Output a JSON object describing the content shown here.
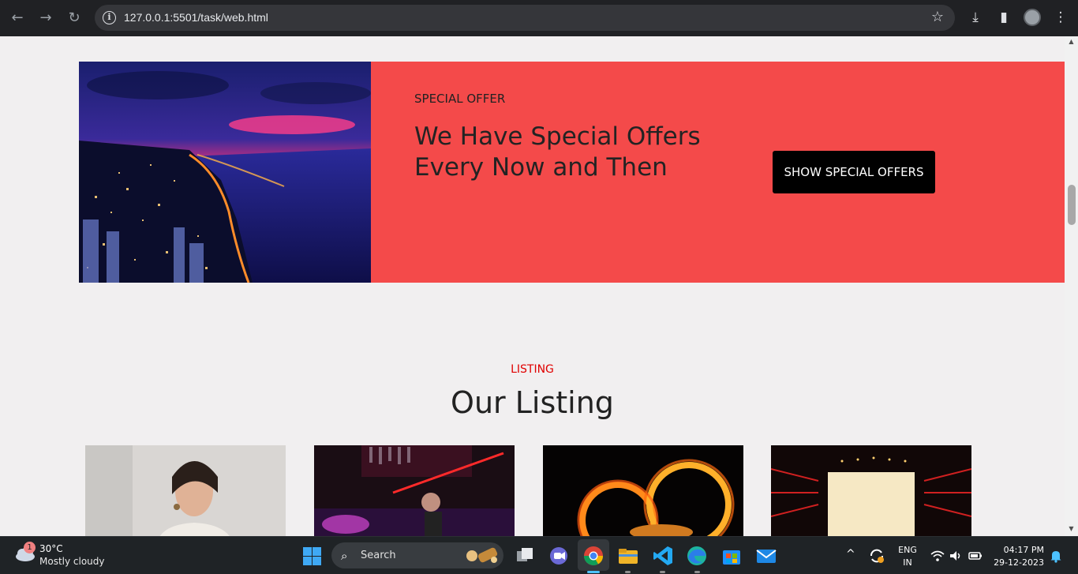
{
  "browser": {
    "url": "127.0.0.1:5501/task/web.html",
    "back_icon": "arrow-left-icon",
    "forward_icon": "arrow-right-icon",
    "reload_icon": "reload-icon",
    "bookmark_icon": "star-icon"
  },
  "offer": {
    "tag": "SPECIAL OFFER",
    "title": "We Have Special Offers Every Now and Then",
    "button": "SHOW SPECIAL OFFERS",
    "accent_color": "#f44a4a"
  },
  "listing": {
    "tag": "LISTING",
    "title": "Our Listing",
    "tag_color": "#e00000"
  },
  "taskbar": {
    "weather": {
      "badge": "1",
      "temp": "30°C",
      "condition": "Mostly cloudy"
    },
    "search_label": "Search",
    "language": {
      "line1": "ENG",
      "line2": "IN"
    },
    "clock": {
      "time": "04:17 PM",
      "date": "29-12-2023"
    }
  }
}
